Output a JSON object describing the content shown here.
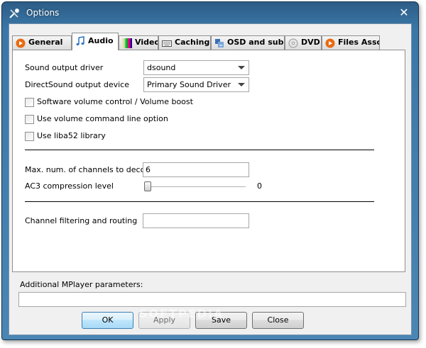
{
  "window": {
    "title": "Options",
    "accent": "#3a77a8"
  },
  "tabs": [
    {
      "label": "General",
      "icon": "play-circle-icon"
    },
    {
      "label": "Audio",
      "icon": "music-note-icon",
      "active": true
    },
    {
      "label": "Video",
      "icon": "color-bars-icon"
    },
    {
      "label": "Caching",
      "icon": "keyboard-icon"
    },
    {
      "label": "OSD and subs",
      "icon": "subtitles-icon"
    },
    {
      "label": "DVD",
      "icon": "dvd-icon"
    },
    {
      "label": "Files Asso",
      "icon": "play-circle-icon"
    }
  ],
  "audio": {
    "sound_output_driver": {
      "label": "Sound output driver",
      "value": "dsound"
    },
    "directsound_device": {
      "label": "DirectSound output device",
      "value": "Primary Sound Driver"
    },
    "checkboxes": [
      {
        "label": "Software volume control / Volume boost",
        "checked": false
      },
      {
        "label": "Use volume command line option",
        "checked": false
      },
      {
        "label": "Use liba52 library",
        "checked": false
      }
    ],
    "max_channels": {
      "label": "Max. num. of channels to decode",
      "value": "6"
    },
    "ac3_level": {
      "label": "AC3 compression level",
      "value": "0",
      "fraction": 0
    },
    "channel_filtering": {
      "label": "Channel filtering and routing",
      "value": ""
    }
  },
  "additional": {
    "label": "Additional MPlayer parameters:",
    "value": ""
  },
  "buttons": {
    "ok": "OK",
    "apply": "Apply",
    "save": "Save",
    "close": "Close"
  },
  "watermark": "SOFTPEDIA"
}
